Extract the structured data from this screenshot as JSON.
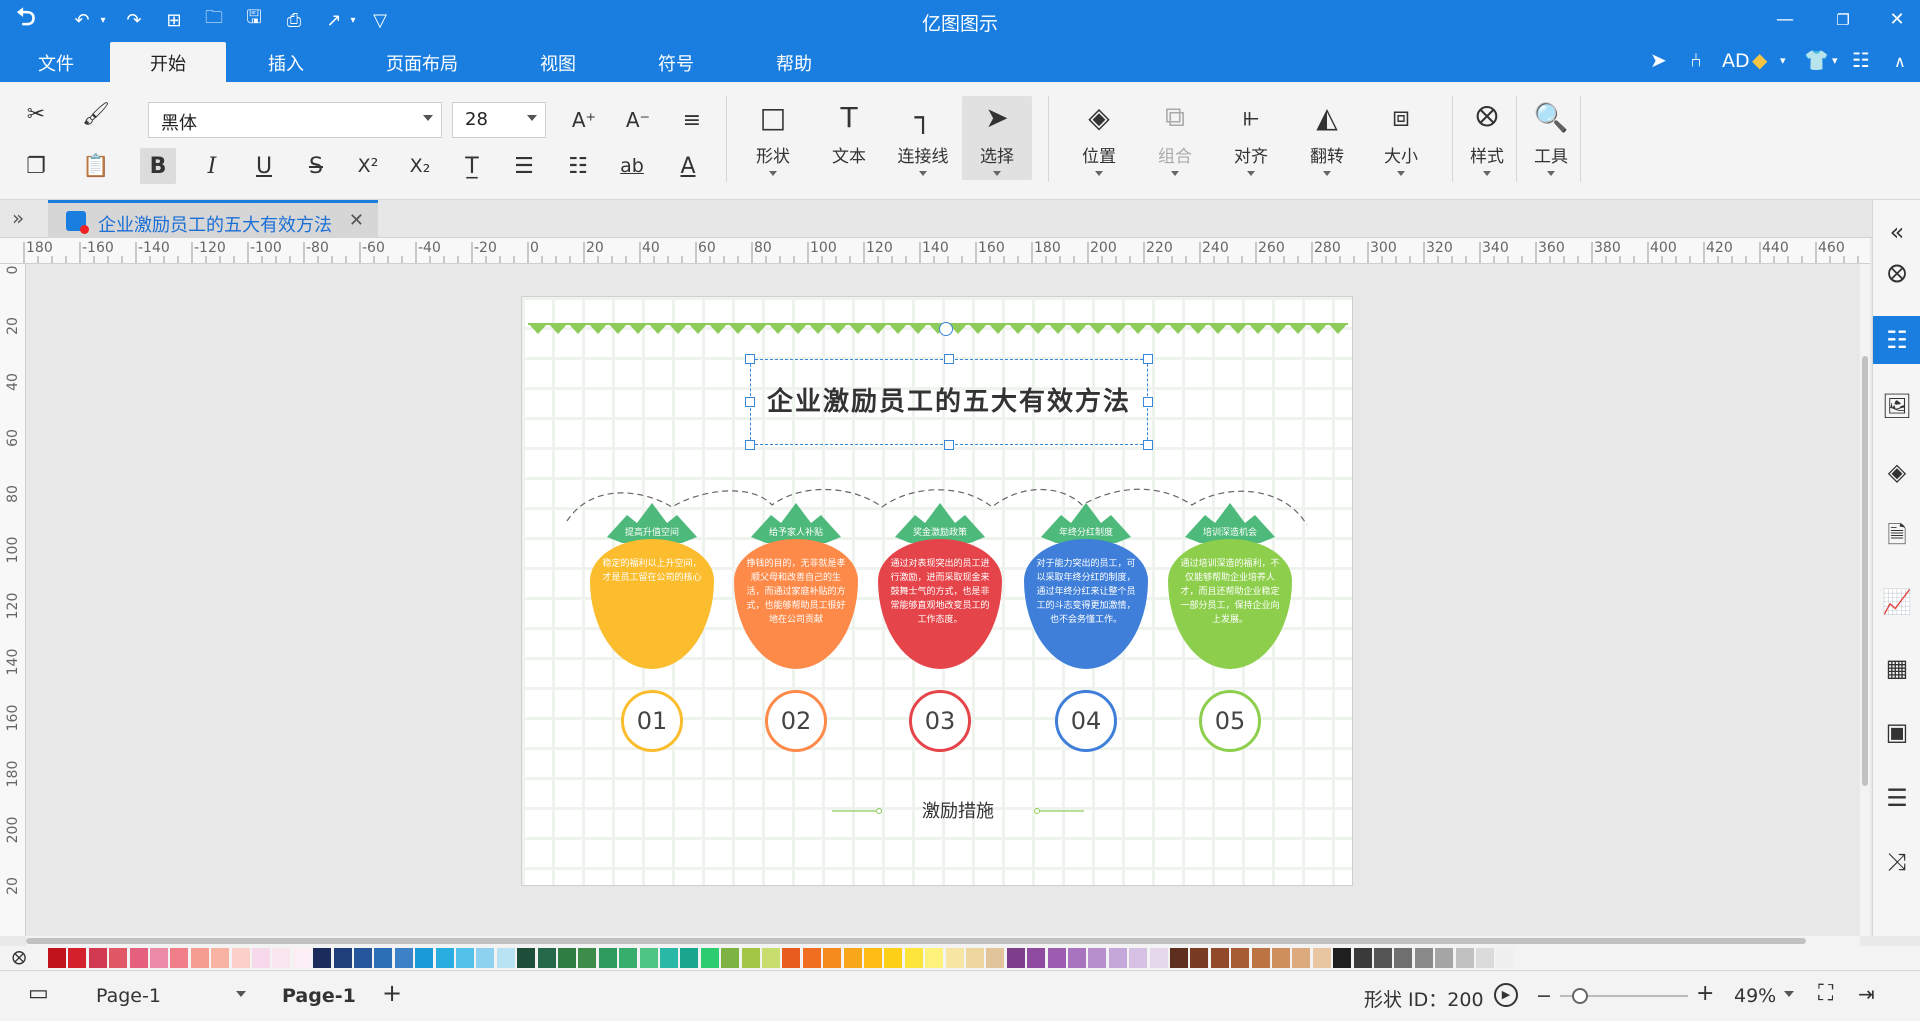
{
  "app": {
    "title": "亿图图示"
  },
  "quick_toolbar": [
    "logo-icon",
    "undo-icon",
    "redo-icon",
    "new-icon",
    "open-icon",
    "save-icon",
    "print-icon",
    "export-icon",
    "customize-icon"
  ],
  "menu": {
    "tabs": [
      {
        "label": "文件"
      },
      {
        "label": "开始",
        "active": true
      },
      {
        "label": "插入"
      },
      {
        "label": "页面布局"
      },
      {
        "label": "视图"
      },
      {
        "label": "符号"
      },
      {
        "label": "帮助"
      }
    ],
    "user": "AD"
  },
  "ribbon": {
    "font_family": "黑体",
    "font_size": "28",
    "big_buttons": [
      {
        "label": "形状"
      },
      {
        "label": "文本"
      },
      {
        "label": "连接线"
      },
      {
        "label": "选择"
      },
      {
        "label": "位置"
      },
      {
        "label": "组合"
      },
      {
        "label": "对齐"
      },
      {
        "label": "翻转"
      },
      {
        "label": "大小"
      },
      {
        "label": "样式"
      },
      {
        "label": "工具"
      }
    ]
  },
  "document_tab": {
    "title": "企业激励员工的五大有效方法"
  },
  "rulers": {
    "horizontal": [
      "180",
      "-160",
      "-140",
      "-120",
      "-100",
      "-80",
      "-60",
      "-40",
      "-20",
      "0",
      "20",
      "40",
      "60",
      "80",
      "100",
      "120",
      "140",
      "160",
      "180",
      "200",
      "220",
      "240",
      "260",
      "280",
      "300",
      "320",
      "340",
      "360",
      "380",
      "400",
      "420",
      "440",
      "460"
    ],
    "vertical": [
      "0",
      "20",
      "40",
      "60",
      "80",
      "100",
      "120",
      "140",
      "160",
      "180",
      "200",
      "20"
    ]
  },
  "diagram": {
    "title": "企业激励员工的五大有效方法",
    "footer": "激励措施",
    "items": [
      {
        "label": "提高升值空间",
        "desc": "稳定的福利以上升空间，才是员工留在公司的核心",
        "number": "01",
        "color": "#fbbd2d"
      },
      {
        "label": "给予家人补贴",
        "desc": "挣钱的目的，无非就是孝顺父母和改善自己的生活，而通过家庭补贴的方式，也能够帮助员工很好地在公司贡献",
        "number": "02",
        "color": "#fe8a4a"
      },
      {
        "label": "奖金激励政策",
        "desc": "通过对表现突出的员工进行激励，进而采取现金来鼓舞士气的方式，也是非常能够直观地改变员工的工作态度。",
        "number": "03",
        "color": "#e5454a"
      },
      {
        "label": "年终分红制度",
        "desc": "对于能力突出的员工，可以采取年终分红的制度，通过年终分红来让整个员工的斗志变得更加激情，也不会务懂工作。",
        "number": "04",
        "color": "#3f7fd9"
      },
      {
        "label": "培训深造机会",
        "desc": "通过培训深造的福利，不仅能够帮助企业培养人才，而且还帮助企业稳定一部分员工，保持企业向上发展。",
        "number": "05",
        "color": "#8dcf4c"
      }
    ]
  },
  "status": {
    "page_selector": "Page-1",
    "page_tab": "Page-1",
    "shape_id": "形状 ID：200",
    "zoom": "49%"
  }
}
